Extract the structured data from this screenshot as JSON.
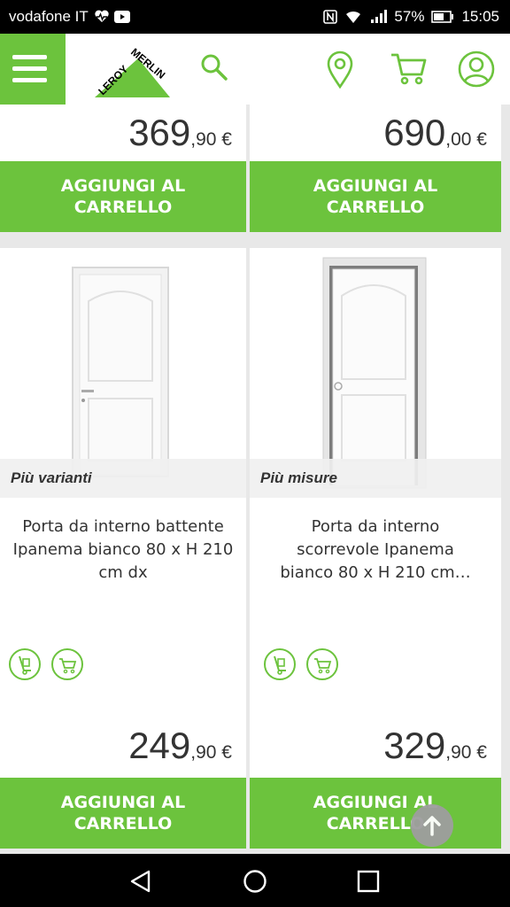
{
  "status_bar": {
    "carrier": "vodafone IT",
    "battery": "57%",
    "time": "15:05"
  },
  "header": {
    "logo_text_1": "LEROY",
    "logo_text_2": "MERLIN",
    "icons": [
      "menu-icon",
      "search-icon",
      "location-pin-icon",
      "cart-icon",
      "user-icon"
    ],
    "accent": "#6cc33d"
  },
  "products_top": [
    {
      "price_int": "369",
      "price_dec": ",90 €",
      "button_label": "AGGIUNGI AL CARRELLO"
    },
    {
      "price_int": "690",
      "price_dec": ",00 €",
      "button_label": "AGGIUNGI AL CARRELLO"
    }
  ],
  "products": [
    {
      "variant_label": "Più varianti",
      "title": "Porta da interno battente Ipanema bianco 80 x H 210 cm dx",
      "price_int": "249",
      "price_dec": ",90 €",
      "button_label": "AGGIUNGI AL CARRELLO"
    },
    {
      "variant_label": "Più misure",
      "title": "Porta da interno scorrevole Ipanema bianco 80 x H 210 cm…",
      "price_int": "329",
      "price_dec": ",90 €",
      "button_label": "AGGIUNGI AL CARRELLO"
    }
  ],
  "nav_bar": {
    "icons": [
      "back-icon",
      "home-icon",
      "recents-icon"
    ]
  }
}
